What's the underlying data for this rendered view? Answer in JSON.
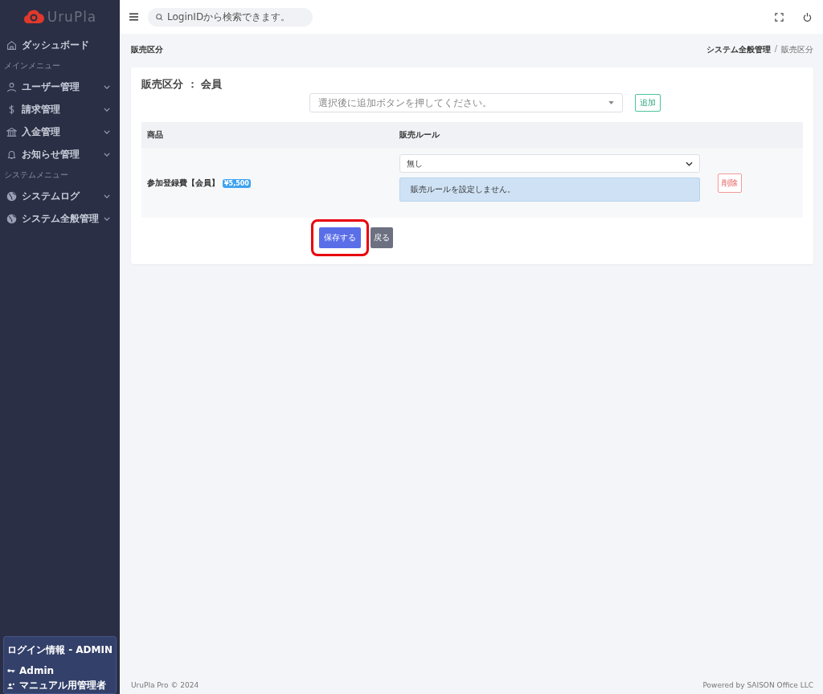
{
  "brand": {
    "name": "UruPla"
  },
  "search": {
    "placeholder": "LoginIDから検索できます。"
  },
  "sidebar": {
    "items": [
      {
        "kind": "item",
        "label": "ダッシュボード",
        "expandable": false
      },
      {
        "kind": "heading",
        "label": "メインメニュー"
      },
      {
        "kind": "item",
        "label": "ユーザー管理",
        "expandable": true
      },
      {
        "kind": "item",
        "label": "請求管理",
        "expandable": true
      },
      {
        "kind": "item",
        "label": "入金管理",
        "expandable": true
      },
      {
        "kind": "item",
        "label": "お知らせ管理",
        "expandable": true
      },
      {
        "kind": "heading",
        "label": "システムメニュー"
      },
      {
        "kind": "item",
        "label": "システムログ",
        "expandable": true
      },
      {
        "kind": "item",
        "label": "システム全般管理",
        "expandable": true
      }
    ],
    "login_info": {
      "title": "ログイン情報 - ADMIN",
      "user": "Admin",
      "role": "マニュアル用管理者"
    }
  },
  "page": {
    "title": "販売区分",
    "breadcrumb": [
      "システム全般管理",
      "販売区分"
    ],
    "breadcrumb_separator": "/"
  },
  "card": {
    "title": "販売区分 ： 会員",
    "product_select": {
      "placeholder": "選択後に追加ボタンを押してください。"
    },
    "add_button": "追加",
    "table": {
      "columns": [
        "商品",
        "販売ルール"
      ],
      "rows": [
        {
          "product": "参加登録費【会員】",
          "price": "¥5,500",
          "rule": "無し",
          "rule_note": "販売ルールを設定しません。",
          "delete_button": "削除"
        }
      ]
    },
    "save_button": {
      "label": "保存する",
      "highlighted": true
    },
    "back_button": "戻る"
  },
  "footer": {
    "left": "UruPla Pro © 2024",
    "right": "Powered by SAISON Office LLC"
  }
}
